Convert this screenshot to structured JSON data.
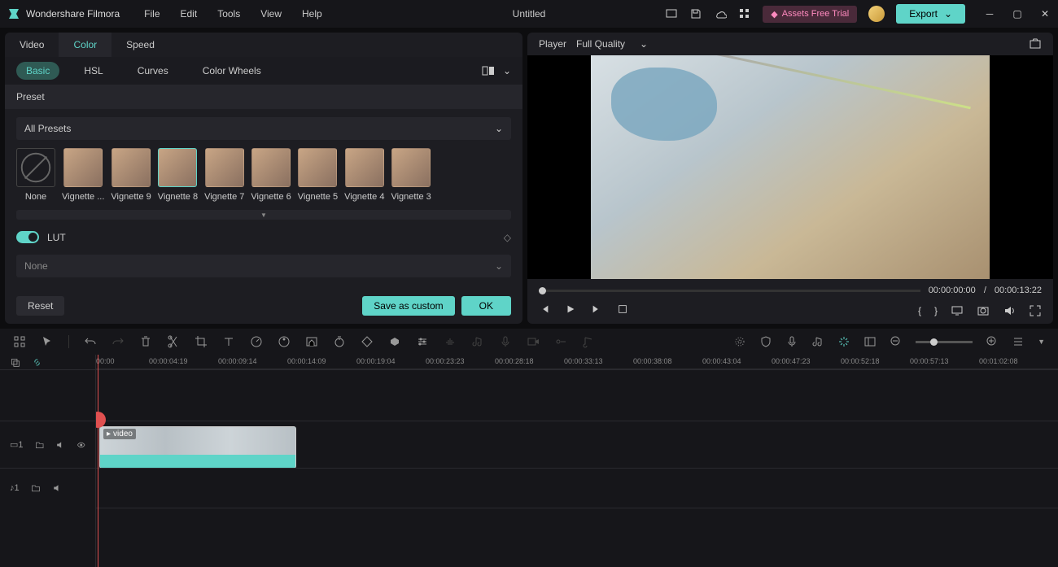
{
  "app": {
    "name": "Wondershare Filmora",
    "title": "Untitled"
  },
  "menu": [
    "File",
    "Edit",
    "Tools",
    "View",
    "Help"
  ],
  "titlebar": {
    "assets": "Assets Free Trial",
    "export": "Export"
  },
  "tabs": {
    "items": [
      "Video",
      "Color",
      "Speed"
    ],
    "active": 1
  },
  "subtabs": {
    "items": [
      "Basic",
      "HSL",
      "Curves",
      "Color Wheels"
    ],
    "active": 0
  },
  "preset": {
    "header": "Preset",
    "select": "All Presets",
    "items": [
      "None",
      "Vignette ...",
      "Vignette 9",
      "Vignette 8",
      "Vignette 7",
      "Vignette 6",
      "Vignette 5",
      "Vignette 4",
      "Vignette 3"
    ]
  },
  "lut": {
    "label": "LUT",
    "select": "None"
  },
  "footer": {
    "reset": "Reset",
    "save": "Save as custom",
    "ok": "OK"
  },
  "player": {
    "label": "Player",
    "quality": "Full Quality",
    "time_current": "00:00:00:00",
    "time_sep": "/",
    "time_total": "00:00:13:22"
  },
  "ruler": [
    "00:00",
    "00:00:04:19",
    "00:00:09:14",
    "00:00:14:09",
    "00:00:19:04",
    "00:00:23:23",
    "00:00:28:18",
    "00:00:33:13",
    "00:00:38:08",
    "00:00:43:04",
    "00:00:47:23",
    "00:00:52:18",
    "00:00:57:13",
    "00:01:02:08"
  ],
  "clip": {
    "label": "video"
  },
  "track": {
    "video": "1",
    "audio": "1"
  }
}
